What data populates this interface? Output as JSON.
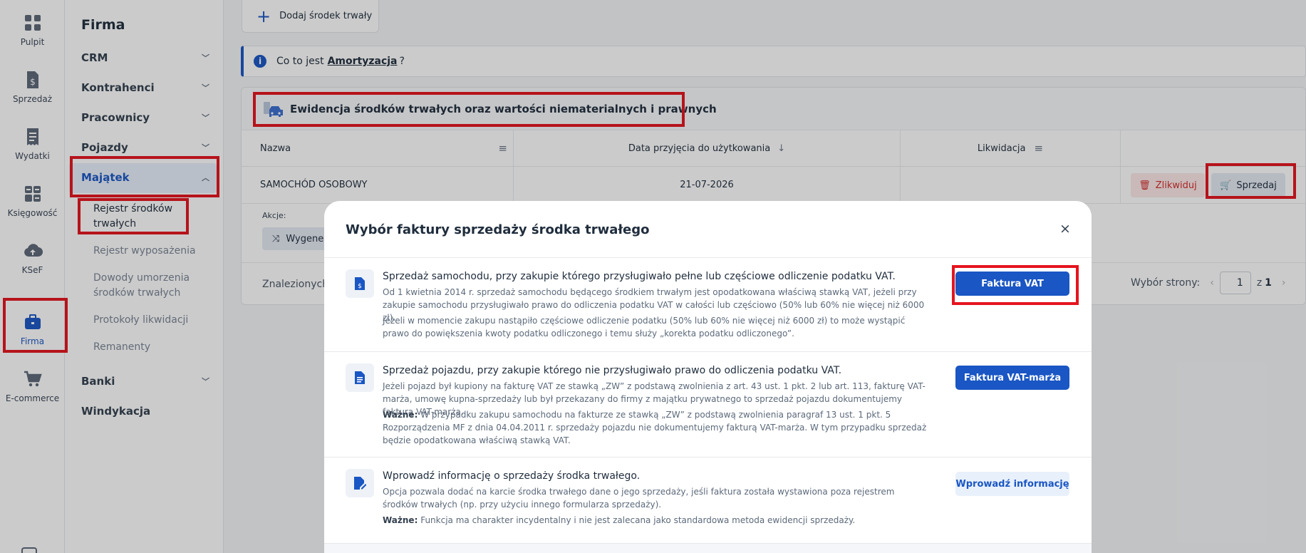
{
  "rail": [
    {
      "label": "Pulpit",
      "icon": "grid-icon"
    },
    {
      "label": "Sprzedaż",
      "icon": "invoice-dollar-icon"
    },
    {
      "label": "Wydatki",
      "icon": "receipt-icon"
    },
    {
      "label": "Księgowość",
      "icon": "calculator-icon"
    },
    {
      "label": "KSeF",
      "icon": "cloud-upload-icon"
    },
    {
      "label": "Firma",
      "icon": "briefcase-icon"
    },
    {
      "label": "E-commerce",
      "icon": "cart-icon"
    }
  ],
  "sidebar": {
    "title": "Firma",
    "items": [
      {
        "label": "CRM"
      },
      {
        "label": "Kontrahenci"
      },
      {
        "label": "Pracownicy"
      },
      {
        "label": "Pojazdy"
      },
      {
        "label": "Majątek"
      },
      {
        "label": "Banki"
      },
      {
        "label": "Windykacja"
      }
    ],
    "children": [
      {
        "label": "Rejestr środków trwałych"
      },
      {
        "label": "Rejestr wyposażenia"
      },
      {
        "label": "Dowody umorzenia środków trwałych"
      },
      {
        "label": "Protokoły likwidacji"
      },
      {
        "label": "Remanenty"
      }
    ]
  },
  "toolbar": {
    "add_label": "Dodaj środek trwały"
  },
  "info": {
    "text": "Co to jest",
    "link": "Amortyzacja",
    "suffix": "?"
  },
  "card": {
    "title": "Ewidencja środków trwałych oraz wartości niematerialnych i prawnych",
    "columns": {
      "name": "Nazwa",
      "date": "Data przyjęcia do użytkowania",
      "liquidation": "Likwidacja"
    },
    "row": {
      "name": "SAMOCHÓD OSOBOWY",
      "date": "21-07-2026"
    },
    "delete_label": "Zlikwiduj",
    "sell_label": "Sprzedaj",
    "actions_label": "Akcje:",
    "generate_label": "Wygeneruj",
    "found_label": "Znalezionych:",
    "pager": {
      "label": "Wybór strony:",
      "current": "1",
      "of": "z",
      "total": "1"
    }
  },
  "modal": {
    "title": "Wybór faktury sprzedaży środka trwałego",
    "close": "×",
    "options": [
      {
        "title": "Sprzedaż samochodu, przy zakupie którego przysługiwało pełne lub częściowe odliczenie podatku VAT.",
        "p1": "Od 1 kwietnia 2014 r. sprzedaż samochodu będącego środkiem trwałym jest opodatkowana właściwą stawką VAT, jeżeli przy zakupie samochodu przysługiwało prawo do odliczenia podatku VAT w całości lub częściowo (50% lub 60% nie więcej niż 6000 zł).",
        "p2": "Jeżeli w momencie zakupu nastąpiło częściowe odliczenie podatku (50% lub 60% nie więcej niż 6000 zł) to może wystąpić prawo do powiększenia kwoty podatku odliczonego i temu służy „korekta podatku odliczonego”.",
        "button": "Faktura VAT"
      },
      {
        "title": "Sprzedaż pojazdu, przy zakupie którego nie przysługiwało prawo do odliczenia podatku VAT.",
        "p1": "Jeżeli pojazd był kupiony na fakturę VAT ze stawką „ZW” z podstawą zwolnienia z art. 43 ust. 1 pkt. 2 lub art. 113, fakturę VAT-marża, umowę kupna-sprzedaży lub był przekazany do firmy z majątku prywatnego to sprzedaż pojazdu dokumentujemy fakturą VAT-marża.",
        "strong": "Ważne:",
        "p2": "W przypadku zakupu samochodu na fakturze ze stawką „ZW” z podstawą zwolnienia paragraf 13 ust. 1 pkt. 5 Rozporządzenia MF z dnia 04.04.2011 r. sprzedaży pojazdu nie dokumentujemy fakturą VAT-marża. W tym przypadku sprzedaż będzie opodatkowana właściwą stawką VAT.",
        "button": "Faktura VAT-marża"
      },
      {
        "title": "Wprowadź informację o sprzedaży środka trwałego.",
        "p1": "Opcja pozwala dodać na karcie środka trwałego dane o jego sprzedaży, jeśli faktura została wystawiona poza rejestrem środków trwałych (np. przy użyciu innego formularza sprzedaży).",
        "strong": "Ważne:",
        "p2": "Funkcja ma charakter incydentalny i nie jest zalecana jako standardowa metoda ewidencji sprzedaży.",
        "button": "Wprowadź informację"
      }
    ]
  },
  "colors": {
    "accent": "#1a56c4",
    "highlight": "#e5141e",
    "danger": "#d22c2c"
  }
}
